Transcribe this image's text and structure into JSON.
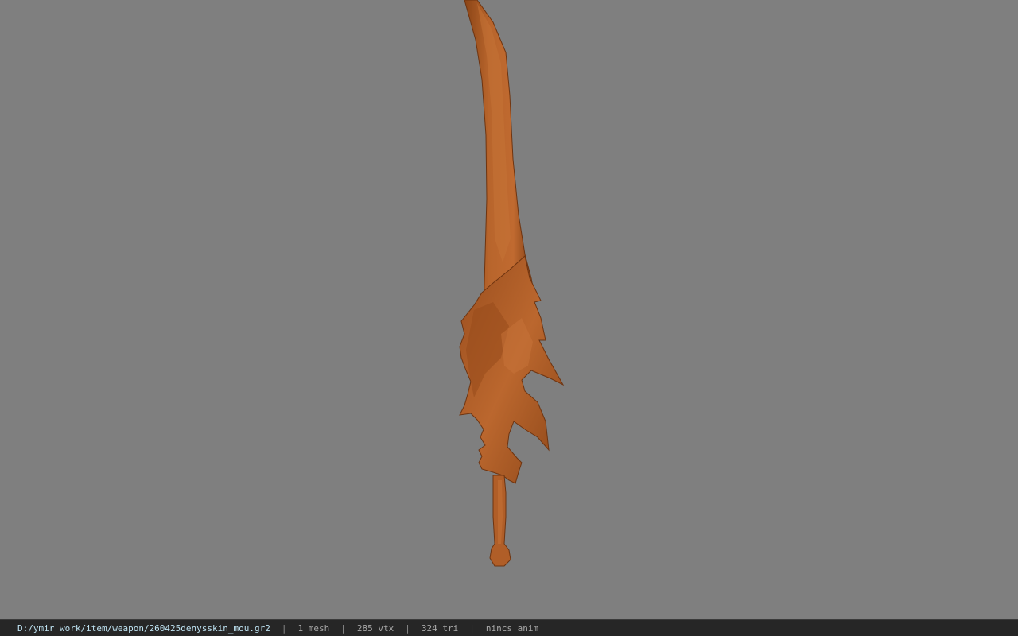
{
  "viewer": {
    "background_color": "#7f7f7f",
    "model_color": "#b3602a",
    "model_icon": "sword-model"
  },
  "status_bar": {
    "file_path": "D:/ymir work/item/weapon/260425denysskin_mou.gr2",
    "separator": "|",
    "mesh_count": "1 mesh",
    "vertex_count": "285 vtx",
    "triangle_count": "324 tri",
    "animation": "nincs anim"
  }
}
